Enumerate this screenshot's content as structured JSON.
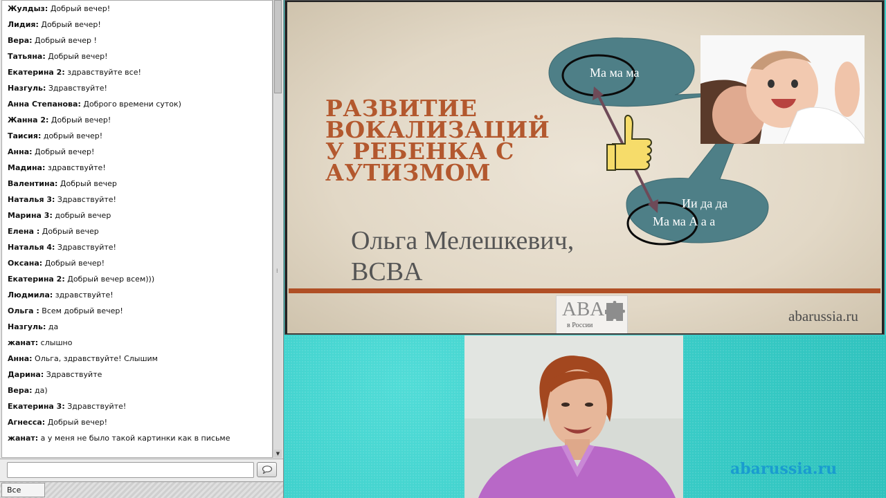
{
  "chat": {
    "messages": [
      {
        "author": "Жулдыз",
        "text": " Добрый вечер!"
      },
      {
        "author": "Лидия",
        "text": " Добрый вечер!"
      },
      {
        "author": "Вера",
        "text": " Добрый вечер !"
      },
      {
        "author": "Татьяна",
        "text": " Добрый вечер!"
      },
      {
        "author": "Екатерина 2",
        "text": " здравствуйте все!"
      },
      {
        "author": "Назгуль",
        "text": " Здравствуйте!"
      },
      {
        "author": "Анна Степанова",
        "text": " Доброго времени суток)"
      },
      {
        "author": "Жанна 2",
        "text": " Добрый вечер!"
      },
      {
        "author": "Таисия",
        "text": " добрый вечер!"
      },
      {
        "author": "Анна",
        "text": " Добрый вечер!"
      },
      {
        "author": "Мадина",
        "text": " здравствуйте!"
      },
      {
        "author": "Валентина",
        "text": " Добрый вечер"
      },
      {
        "author": "Наталья 3",
        "text": " Здравствуйте!"
      },
      {
        "author": "Марина 3",
        "text": " добрый вечер"
      },
      {
        "author": "Елена ",
        "text": " Добрый вечер"
      },
      {
        "author": "Наталья 4",
        "text": " Здравствуйте!"
      },
      {
        "author": "Оксана",
        "text": " Добрый вечер!"
      },
      {
        "author": "Екатерина 2",
        "text": " Добрый вечер всем)))"
      },
      {
        "author": "Людмила",
        "text": " здравствуйте!"
      },
      {
        "author": "Ольга ",
        "text": " Всем добрый вечер!"
      },
      {
        "author": "Назгуль",
        "text": " да"
      },
      {
        "author": "жанат",
        "text": " слышно"
      },
      {
        "author": "Анна",
        "text": " Ольга, здравствуйте! Слышим"
      },
      {
        "author": "Дарина",
        "text": " Здравствуйте"
      },
      {
        "author": "Вера",
        "text": " да)"
      },
      {
        "author": "Екатерина 3",
        "text": " Здравствуйте!"
      },
      {
        "author": "Агнесса",
        "text": " Добрый вечер!"
      },
      {
        "author": "жанат",
        "text": " а у меня не было такой картинки как в письме"
      }
    ],
    "input_value": "",
    "audience_select": "Все"
  },
  "slide": {
    "title_lines": [
      "РАЗВИТИЕ",
      "ВОКАЛИЗАЦИЙ",
      "У РЕБЕНКА С",
      "АУТИЗМОМ"
    ],
    "author_line1": "Ольга Мелешкевич,",
    "author_line2": "BCBA",
    "bubble_top_text": "Ма ма ма",
    "bubble_bottom_line1": "Ии  да да",
    "bubble_bottom_line2": "Ма ма А а а",
    "logo_text": "ABA",
    "logo_sub": "в России",
    "site": "abarussia.ru",
    "colors": {
      "title": "#b3582e",
      "bubble": "#4e7f87",
      "rule": "#b04f25"
    }
  },
  "webcam": {
    "watermark": "abarussia.ru"
  }
}
